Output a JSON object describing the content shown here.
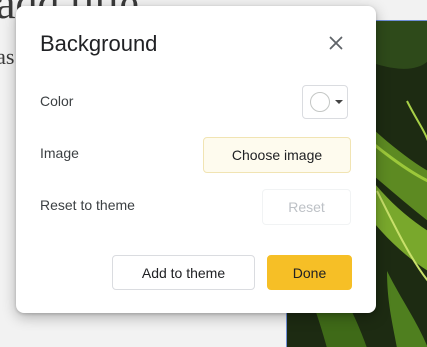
{
  "backdrop": {
    "title_fragment": "add title",
    "subtitle_fragment": "tas"
  },
  "dialog": {
    "title": "Background",
    "close_icon": "close-icon",
    "color_row": {
      "label": "Color",
      "swatch_color": "#ffffff"
    },
    "image_row": {
      "label": "Image",
      "button_label": "Choose image"
    },
    "reset_row": {
      "label": "Reset to theme",
      "button_label": "Reset",
      "button_disabled": true
    },
    "footer": {
      "add_to_theme_label": "Add to theme",
      "done_label": "Done"
    }
  },
  "colors": {
    "accent": "#f6bf26",
    "choose_image_bg": "#fefbee",
    "text_primary": "#202124",
    "text_disabled": "#bdc1c6"
  }
}
